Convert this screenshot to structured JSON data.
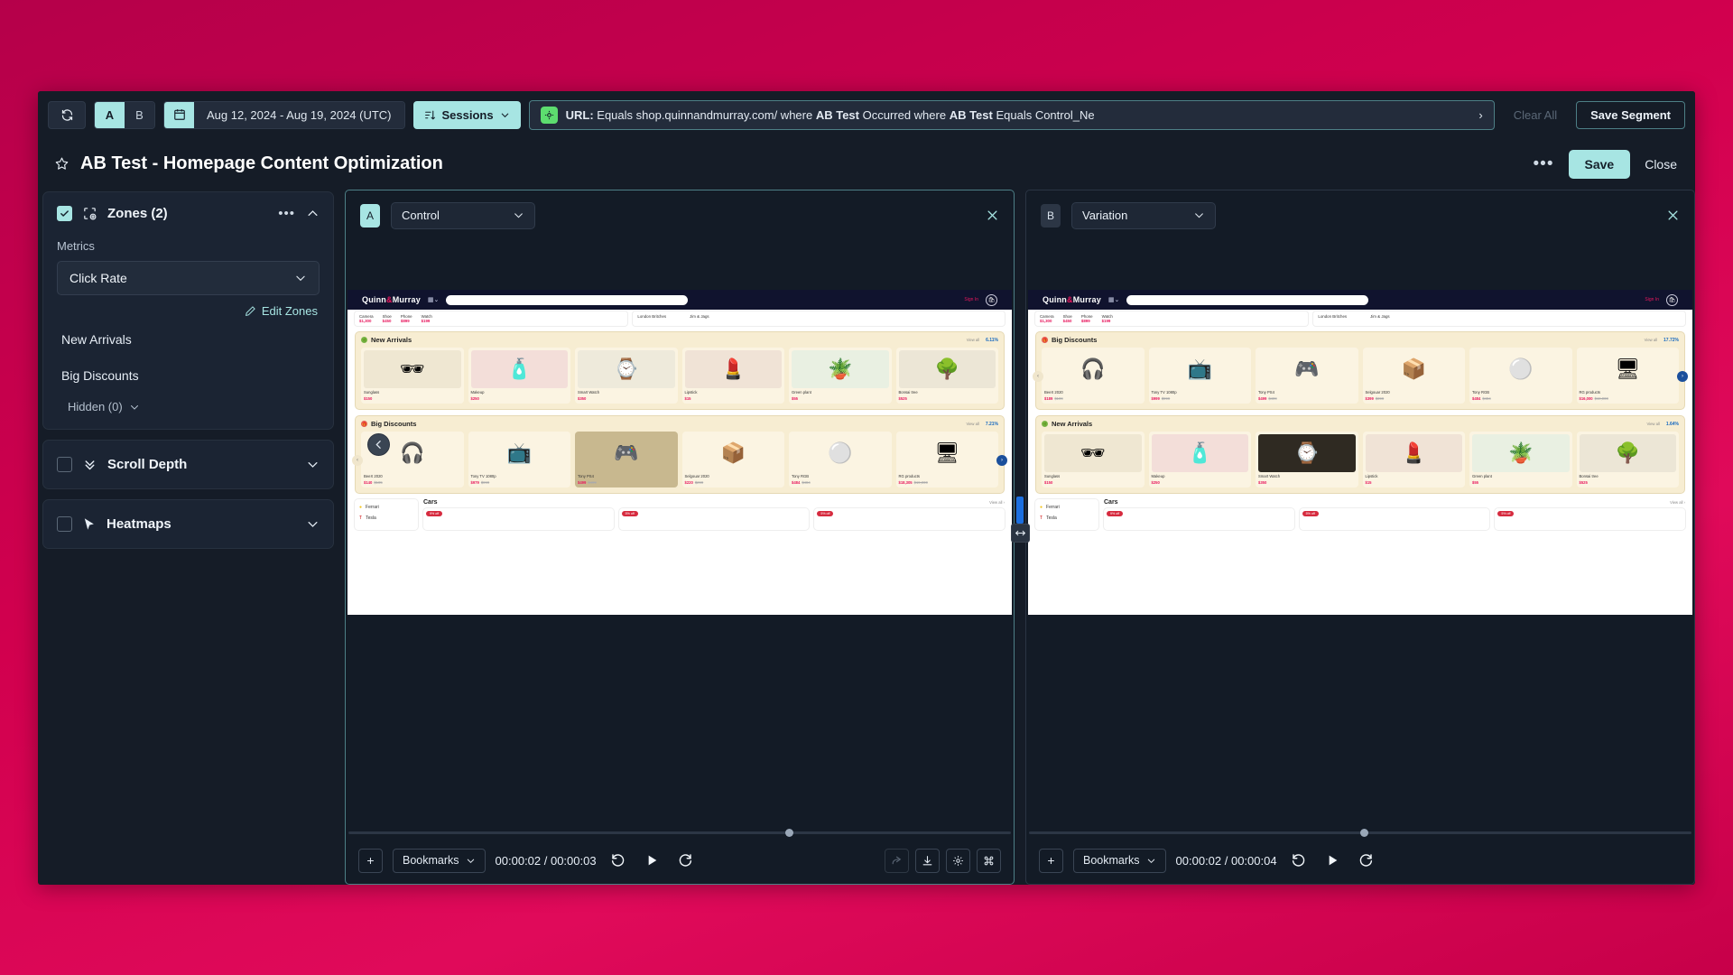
{
  "filterbar": {
    "refresh_icon": "refresh-icon",
    "ab_toggle": {
      "a": "A",
      "b": "B"
    },
    "date_range": "Aug 12, 2024 - Aug 19, 2024 (UTC)",
    "sessions_label": "Sessions",
    "filter": {
      "prefix": "URL:",
      "text_1": " Equals shop.quinnandmurray.com/ where ",
      "bold_1": "AB Test",
      "text_2": " Occurred where ",
      "bold_2": "AB Test",
      "text_3": " Equals Control_Ne",
      "arrow": "›"
    },
    "clear_all": "Clear All",
    "save_segment": "Save Segment"
  },
  "titlebar": {
    "star_icon": "star-icon",
    "title": "AB Test - Homepage Content Optimization",
    "more": "•••",
    "save": "Save",
    "close": "Close"
  },
  "sidebar": {
    "zones": {
      "title": "Zones (2)",
      "more": "•••",
      "metrics_label": "Metrics",
      "metric_value": "Click Rate",
      "edit_zones": "Edit Zones",
      "items": [
        "New Arrivals",
        "Big Discounts"
      ],
      "hidden": "Hidden (0)"
    },
    "scroll_depth": {
      "title": "Scroll Depth"
    },
    "heatmaps": {
      "title": "Heatmaps"
    }
  },
  "panels": [
    {
      "badge": "A",
      "variant": "Control",
      "player": {
        "add": "+",
        "bookmarks": "Bookmarks",
        "timecode": "00:00:02 / 00:00:03",
        "rewind_icon": "rewind-icon",
        "play_icon": "play-icon",
        "forward_icon": "forward-icon",
        "share_icon": "share-icon",
        "download_icon": "download-icon",
        "settings_icon": "gear-icon",
        "shortcuts_icon": "command-icon"
      },
      "site": {
        "brand_left": "Quinn",
        "brand_amp": "&",
        "brand_right": "Murray",
        "signin": "Sign In",
        "top_products": [
          {
            "name": "Camera",
            "price": "$1,300"
          },
          {
            "name": "Shoe",
            "price": "$450"
          },
          {
            "name": "Phone",
            "price": "$899"
          },
          {
            "name": "Watch",
            "price": "$199"
          }
        ],
        "top_cards": [
          "London Britches",
          "Jim & Jags"
        ],
        "sections": [
          {
            "title": "New Arrivals",
            "icon": "leaf-icon",
            "view_all": "View all",
            "pct": "6.11%",
            "products": [
              {
                "name": "Sunglass",
                "price": "$150",
                "glyph": "🕶",
                "bg": "#efe7d2"
              },
              {
                "name": "Makeup",
                "price": "$250",
                "glyph": "🧴",
                "bg": "#f3ded9"
              },
              {
                "name": "Smart Watch",
                "price": "$350",
                "glyph": "⌚",
                "bg": "#eeeadb"
              },
              {
                "name": "Lipstick",
                "price": "$15",
                "glyph": "💄",
                "bg": "#f0e3d6"
              },
              {
                "name": "Green plant",
                "price": "$55",
                "glyph": "🪴",
                "bg": "#e9f0e2"
              },
              {
                "name": "Bonsai tree",
                "price": "$525",
                "glyph": "🌳",
                "bg": "#ece6d6"
              }
            ]
          },
          {
            "title": "Big Discounts",
            "icon": "gift-icon",
            "view_all": "View all",
            "pct": "7.21%",
            "products": [
              {
                "name": "BeeX 2020",
                "price": "$140",
                "old": "$185",
                "glyph": "🎧",
                "bg": "#f3ead4"
              },
              {
                "name": "Tony TV 1080p",
                "price": "$979",
                "old": "$999",
                "glyph": "📺",
                "bg": "#f3ead4"
              },
              {
                "name": "Tony PS4",
                "price": "$499",
                "old": "$499",
                "glyph": "🎮",
                "bg": "#c8b88f"
              },
              {
                "name": "Selgouar 2020",
                "price": "$220",
                "old": "$299",
                "glyph": "📦",
                "bg": "#f3ead4"
              },
              {
                "name": "Tony RGB",
                "price": "$484",
                "old": "$484",
                "glyph": "⚪",
                "bg": "#f3ead4"
              },
              {
                "name": "RG products",
                "price": "$18,305",
                "old": "$19,000",
                "glyph": "🖥",
                "bg": "#f3ead4"
              }
            ]
          }
        ],
        "cars": {
          "title": "Cars",
          "view_all": "View all ›",
          "brands": [
            "Ferrari",
            "Tesla"
          ],
          "badges": [
            "9% off",
            "5% off",
            "5% off"
          ]
        }
      }
    },
    {
      "badge": "B",
      "variant": "Variation",
      "player": {
        "add": "+",
        "bookmarks": "Bookmarks",
        "timecode": "00:00:02 / 00:00:04",
        "rewind_icon": "rewind-icon",
        "play_icon": "play-icon",
        "forward_icon": "forward-icon",
        "share_icon": "share-icon",
        "download_icon": "download-icon",
        "settings_icon": "gear-icon",
        "shortcuts_icon": "command-icon"
      },
      "site": {
        "brand_left": "Quinn",
        "brand_amp": "&",
        "brand_right": "Murray",
        "signin": "Sign In",
        "top_products": [
          {
            "name": "Camera",
            "price": "$1,300"
          },
          {
            "name": "Shoe",
            "price": "$450"
          },
          {
            "name": "Phone",
            "price": "$899"
          },
          {
            "name": "Watch",
            "price": "$199"
          }
        ],
        "top_cards": [
          "London Britches",
          "Jim & Jags"
        ],
        "sections": [
          {
            "title": "Big Discounts",
            "icon": "gift-icon",
            "view_all": "View all",
            "pct": "17.72%",
            "products": [
              {
                "name": "BeeX 2020",
                "price": "$189",
                "old": "$199",
                "glyph": "🎧",
                "bg": "#f3ead4"
              },
              {
                "name": "Tony TV 1080p",
                "price": "$999",
                "old": "$999",
                "glyph": "📺",
                "bg": "#f3ead4"
              },
              {
                "name": "Tony PS4",
                "price": "$499",
                "old": "$499",
                "glyph": "🎮",
                "bg": "#f3ead4"
              },
              {
                "name": "Selgouar 2020",
                "price": "$399",
                "old": "$399",
                "glyph": "📦",
                "bg": "#f3ead4"
              },
              {
                "name": "Tony RGB",
                "price": "$484",
                "old": "$484",
                "glyph": "⚪",
                "bg": "#f3ead4"
              },
              {
                "name": "RG products",
                "price": "$16,000",
                "old": "$19,000",
                "glyph": "🖥",
                "bg": "#f3ead4"
              }
            ]
          },
          {
            "title": "New Arrivals",
            "icon": "leaf-icon",
            "view_all": "View all",
            "pct": "1.64%",
            "products": [
              {
                "name": "Sunglass",
                "price": "$150",
                "glyph": "🕶",
                "bg": "#efe7d2"
              },
              {
                "name": "Makeup",
                "price": "$250",
                "glyph": "🧴",
                "bg": "#f3ded9"
              },
              {
                "name": "Smart Watch",
                "price": "$350",
                "glyph": "⌚",
                "bg": "#2f2a22"
              },
              {
                "name": "Lipstick",
                "price": "$15",
                "glyph": "💄",
                "bg": "#f0e3d6"
              },
              {
                "name": "Green plant",
                "price": "$55",
                "glyph": "🪴",
                "bg": "#e9f0e2"
              },
              {
                "name": "Bonsai tree",
                "price": "$525",
                "glyph": "🌳",
                "bg": "#ece6d6"
              }
            ]
          }
        ],
        "cars": {
          "title": "Cars",
          "view_all": "View all ›",
          "brands": [
            "Ferrari",
            "Tesla"
          ],
          "badges": [
            "9% off",
            "5% off",
            "5% off"
          ]
        }
      }
    }
  ],
  "colors": {
    "accent": "#a7e5e3",
    "app_bg": "#151c27",
    "card_bg": "#1b2433",
    "desktop": "#c70049",
    "marker_blue": "#1c6fe0"
  }
}
